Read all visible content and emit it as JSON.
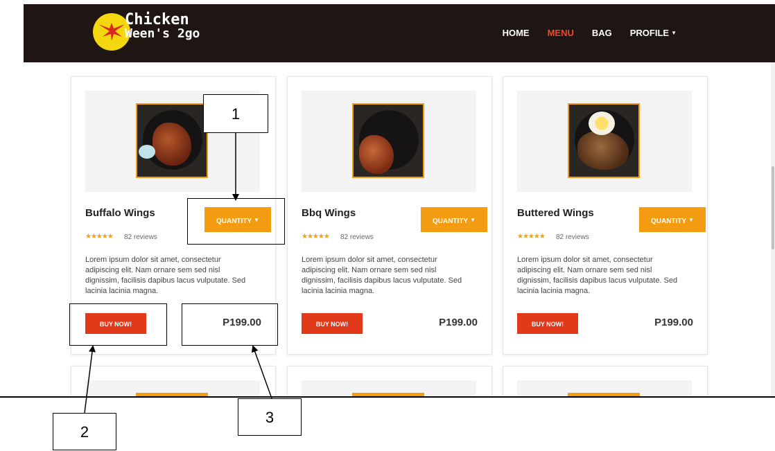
{
  "brand": {
    "line1": "Chicken",
    "line2": "Ween's 2go"
  },
  "nav": {
    "home": "HOME",
    "menu": "MENU",
    "bag": "BAG",
    "profile": "PROFILE"
  },
  "products": [
    {
      "name": "Buffalo Wings",
      "quantity_label": "QUANTITY",
      "stars": "★★★★★",
      "reviews": "82 reviews",
      "description": "Lorem ipsum dolor sit amet, consectetur adipiscing elit. Nam ornare sem sed nisl dignissim, facilisis dapibus lacus vulputate. Sed lacinia lacinia magna.",
      "buy_label": "BUY NOW!",
      "price": "P199.00"
    },
    {
      "name": "Bbq Wings",
      "quantity_label": "QUANTITY",
      "stars": "★★★★★",
      "reviews": "82 reviews",
      "description": "Lorem ipsum dolor sit amet, consectetur adipiscing elit. Nam ornare sem sed nisl dignissim, facilisis dapibus lacus vulputate. Sed lacinia lacinia magna.",
      "buy_label": "BUY NOW!",
      "price": "P199.00"
    },
    {
      "name": "Buttered Wings",
      "quantity_label": "QUANTITY",
      "stars": "★★★★★",
      "reviews": "82 reviews",
      "description": "Lorem ipsum dolor sit amet, consectetur adipiscing elit. Nam ornare sem sed nisl dignissim, facilisis dapibus lacus vulputate. Sed lacinia lacinia magna.",
      "buy_label": "BUY NOW!",
      "price": "P199.00"
    }
  ],
  "callouts": {
    "c1": "1",
    "c2": "2",
    "c3": "3"
  },
  "colors": {
    "navbar": "#1f1513",
    "accent_orange": "#f39c12",
    "buy_red": "#e03a1a",
    "active_link": "#e8492c"
  },
  "icons": {
    "logo": "chicken-wing-logo-icon",
    "profile_caret": "caret-down-icon",
    "quantity_caret": "caret-down-icon"
  }
}
